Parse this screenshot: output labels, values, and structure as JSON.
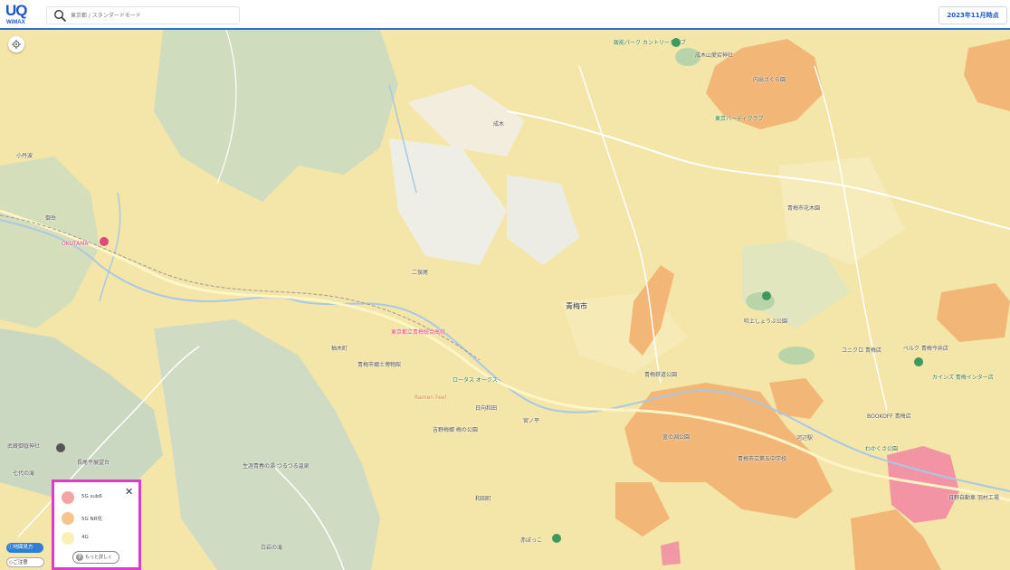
{
  "header": {
    "logo_text": "UQ",
    "logo_sub": "WiMAX",
    "search_placeholder": "東京都 / スタンダードモード",
    "date_label": "2023年11月時点"
  },
  "map_controls": {
    "howto_label": "地図見方",
    "caution_label": "ご注意"
  },
  "legend": {
    "items": [
      {
        "label": "5G sub6",
        "color": "#f5a3a3"
      },
      {
        "label": "5G NR化",
        "color": "#f7c58c"
      },
      {
        "label": "4G",
        "color": "#fbf0b3"
      }
    ],
    "more_label": "もっと詳しく",
    "close_symbol": "✕"
  },
  "map_labels": {
    "city": "青梅市",
    "places": [
      "飯能パーク カントリークラブ",
      "成木山愛宕神社",
      "内出さくら園",
      "東京バーディクラブ",
      "小丹波",
      "御岳",
      "OKUTAMA",
      "青梅市役所",
      "東京都立青梅総合高校",
      "ロータス オークス",
      "吉野梅郷 梅の公園",
      "日向和田",
      "宮ノ平",
      "青梅市郷土博物館",
      "青梅市花木園",
      "吹上しょうぶ公園",
      "ユニクロ 青梅店",
      "ベルク 青梅今井店",
      "カインズ 青梅インター店",
      "BOOKOFF 青梅店",
      "わかくさ公園",
      "日野自動車 羽村工場",
      "河辺駅",
      "永山公園",
      "青梅市立第五中学校",
      "武蔵御嶽神社",
      "七代の滝",
      "長尾平展望台",
      "生涯青春の湯 つるつる温泉",
      "日の出山",
      "白岩の滝",
      "赤ぼっこ",
      "和田町",
      "Ramen Feel",
      "青梅鉄道公園",
      "二俣尾",
      "柚木町",
      "釜の淵公園",
      "霞台",
      "成木"
    ]
  },
  "colors": {
    "accent": "#1a56c9",
    "legend_border": "#e03acb",
    "coverage_5g_sub6": "#f5a3a3",
    "coverage_5g_nr": "#f7c58c",
    "coverage_4g": "#fbf0b3"
  }
}
